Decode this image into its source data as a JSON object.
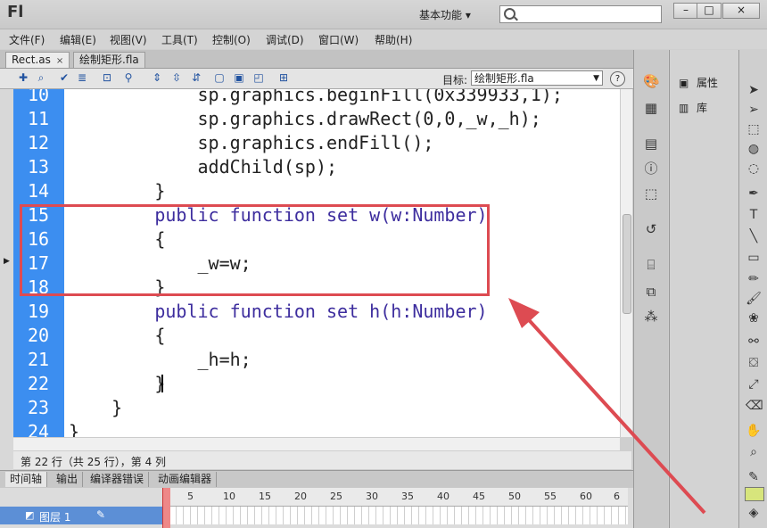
{
  "app": {
    "logo": "Fl",
    "workspace": "基本功能",
    "workspace_arrow": "▾"
  },
  "window_controls": {
    "minimize": "–",
    "maximize": "□",
    "close": "×"
  },
  "menu": [
    "文件(F)",
    "编辑(E)",
    "视图(V)",
    "工具(T)",
    "控制(O)",
    "调试(D)",
    "窗口(W)",
    "帮助(H)"
  ],
  "tabs": [
    {
      "label": "Rect.as",
      "close": "×"
    },
    {
      "label": "绘制矩形.fla"
    }
  ],
  "toolbar": {
    "icons": [
      "add-icon",
      "find-icon",
      "check-syntax-icon",
      "auto-format-icon",
      "code-hint-icon",
      "debug-icon",
      "collapse-icon",
      "collapse-selection-icon",
      "expand-all-icon",
      "comment-block-icon",
      "comment-line-icon",
      "uncomment-icon",
      "snippets-icon"
    ],
    "target_label": "目标:",
    "target_value": "绘制矩形.fla"
  },
  "editor": {
    "lines": [
      {
        "n": "10",
        "code": "            sp.graphics.beginFill(0x339933,1);"
      },
      {
        "n": "11",
        "code": "            sp.graphics.drawRect(0,0,_w,_h);"
      },
      {
        "n": "12",
        "code": "            sp.graphics.endFill();"
      },
      {
        "n": "13",
        "code": "            addChild(sp);"
      },
      {
        "n": "14",
        "code": "        }"
      },
      {
        "n": "15",
        "code": "        public function set w(w:Number)"
      },
      {
        "n": "16",
        "code": "        {"
      },
      {
        "n": "17",
        "code": "            _w=w;"
      },
      {
        "n": "18",
        "code": "        }"
      },
      {
        "n": "19",
        "code": "        public function set h(h:Number)"
      },
      {
        "n": "20",
        "code": "        {"
      },
      {
        "n": "21",
        "code": "            _h=h;"
      },
      {
        "n": "22",
        "code": "        }"
      },
      {
        "n": "23",
        "code": "    }"
      },
      {
        "n": "24",
        "code": "}"
      }
    ]
  },
  "status": "第 22 行（共 25 行），第 4 列",
  "bottom_tabs": [
    "时间轴",
    "输出",
    "编译器错误",
    "动画编辑器"
  ],
  "timeline": {
    "ruler": [
      "5",
      "10",
      "15",
      "20",
      "25",
      "30",
      "35",
      "40",
      "45",
      "50",
      "55",
      "60",
      "6"
    ],
    "layer_name": "图层 1"
  },
  "panels": [
    {
      "label": "属性",
      "icon": "properties-icon"
    },
    {
      "label": "库",
      "icon": "library-icon"
    }
  ],
  "colors": {
    "gutter": "#3c8ef0",
    "keyword": "#3d2d9e",
    "highlight": "#dd4b52",
    "fill_swatch": "#d7e57c"
  }
}
